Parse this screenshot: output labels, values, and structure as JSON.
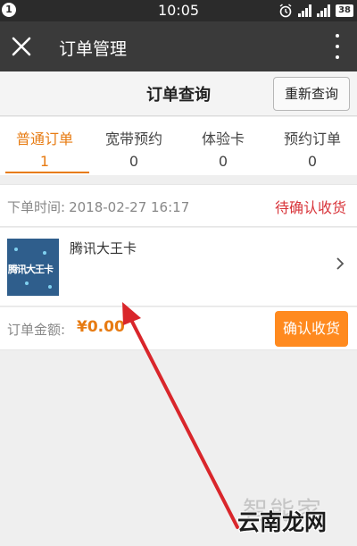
{
  "status_bar": {
    "notification_count": "1",
    "time": "10:05",
    "network_label": "4G",
    "battery": "38",
    "icons": [
      "alarm-icon",
      "signal-icon",
      "signal-icon",
      "battery-icon"
    ]
  },
  "nav": {
    "title": "订单管理",
    "close_icon": "close-icon",
    "more_icon": "more-vertical-icon"
  },
  "page": {
    "title": "订单查询",
    "requery_label": "重新查询"
  },
  "tabs": [
    {
      "label": "普通订单",
      "count": "1",
      "active": true
    },
    {
      "label": "宽带预约",
      "count": "0",
      "active": false
    },
    {
      "label": "体验卡",
      "count": "0",
      "active": false
    },
    {
      "label": "预约订单",
      "count": "0",
      "active": false
    }
  ],
  "order": {
    "time_label": "下单时间:",
    "time_value": "2018-02-27   16:17",
    "status": "待确认收货",
    "product_name": "腾讯大王卡",
    "thumbnail_text": "腾讯大王卡",
    "amount_label": "订单金额:",
    "amount": "¥0.00",
    "confirm_label": "确认收货"
  },
  "watermark": {
    "back": "智能家",
    "front": "云南龙网"
  },
  "colors": {
    "accent": "#e77b12",
    "status_red": "#d8343a",
    "confirm_button": "#ff8a1f",
    "navbar": "#3a3a3a",
    "arrow": "#d9262b"
  }
}
